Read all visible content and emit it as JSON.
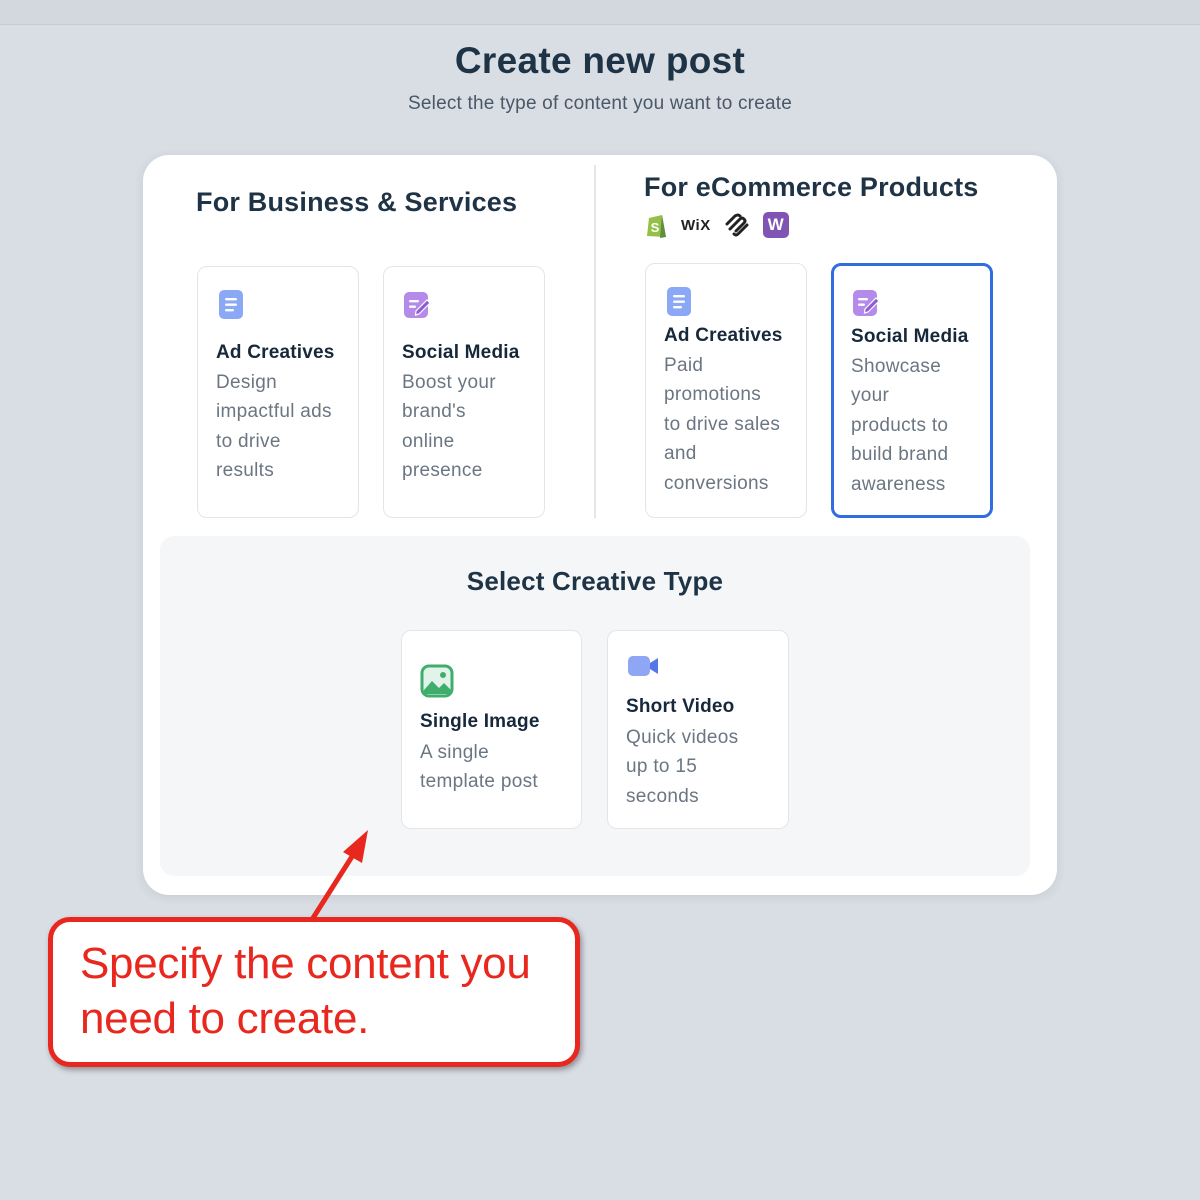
{
  "header": {
    "title": "Create new post",
    "subtitle": "Select the type of content you want to create"
  },
  "business": {
    "title": "For Business & Services",
    "cards": [
      {
        "title": "Ad Creatives",
        "desc_lines": [
          "Design",
          "impactful ads",
          "to drive",
          "results"
        ],
        "icon": "document-icon",
        "icon_color": "#8aa8f5"
      },
      {
        "title": "Social Media",
        "desc_lines": [
          "Boost your",
          "brand's",
          "online",
          "presence"
        ],
        "icon": "edit-icon",
        "icon_color": "#b48be8"
      }
    ]
  },
  "ecommerce": {
    "title": "For eCommerce Products",
    "platforms": [
      "shopify-logo",
      "wix",
      "squarespace-logo",
      "W"
    ],
    "wix_label": "WiX",
    "woo_label": "W",
    "cards": [
      {
        "title": "Ad Creatives",
        "desc_lines": [
          "Paid",
          "promotions",
          "to drive sales",
          "and",
          "conversions"
        ],
        "icon": "document-icon",
        "icon_color": "#8aa8f5",
        "selected": false
      },
      {
        "title": "Social Media",
        "desc_lines": [
          "Showcase",
          "your",
          "products to",
          "build brand",
          "awareness"
        ],
        "icon": "edit-icon",
        "icon_color": "#b48be8",
        "selected": true
      }
    ]
  },
  "creative_type": {
    "title": "Select Creative Type",
    "cards": [
      {
        "title": "Single Image",
        "desc_lines": [
          "A single",
          "template post"
        ],
        "icon": "image-icon",
        "icon_color": "#3fae6d"
      },
      {
        "title": "Short Video",
        "desc_lines": [
          "Quick videos",
          "up to 15",
          "seconds"
        ],
        "icon": "video-camera-icon",
        "icon_color": "#7b96f0"
      }
    ]
  },
  "callout": {
    "lines": [
      "Specify the content you",
      "need to create."
    ]
  },
  "colors": {
    "accent_selected": "#2f6ee0",
    "callout_red": "#e8281e",
    "background": "#d9dee4"
  }
}
